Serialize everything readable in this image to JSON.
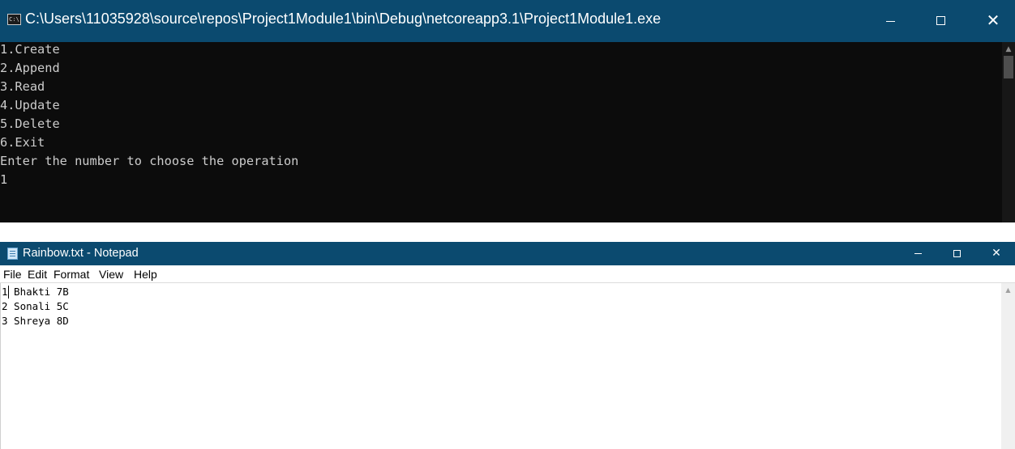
{
  "console": {
    "title": "C:\\Users\\11035928\\source\\repos\\Project1Module1\\bin\\Debug\\netcoreapp3.1\\Project1Module1.exe",
    "icon": "console-app-icon",
    "icon_text": "C:\\",
    "window_controls": {
      "minimize": "minimize-icon",
      "maximize": "maximize-icon",
      "close": "close-icon",
      "close_glyph": "✕"
    },
    "lines": [
      "1.Create",
      "2.Append",
      "3.Read",
      "4.Update",
      "5.Delete",
      "6.Exit",
      "Enter the number to choose the operation",
      "1"
    ],
    "scroll_up_glyph": "▲",
    "colors": {
      "titlebar": "#0b4a6f",
      "background": "#0c0c0c",
      "text": "#cccccc"
    }
  },
  "notepad": {
    "title": "Rainbow.txt - Notepad",
    "icon": "notepad-app-icon",
    "window_controls": {
      "minimize": "minimize-icon",
      "maximize": "maximize-icon",
      "close": "close-icon",
      "close_glyph": "✕"
    },
    "menu": [
      "File",
      "Edit",
      "Format",
      "View",
      "Help"
    ],
    "content_lines": [
      "1 Bhakti 7B",
      "2 Sonali 5C",
      "3 Shreya 8D"
    ],
    "scroll_up_glyph": "▲",
    "colors": {
      "titlebar": "#0b4a6f",
      "background": "#ffffff",
      "text": "#000000"
    }
  }
}
